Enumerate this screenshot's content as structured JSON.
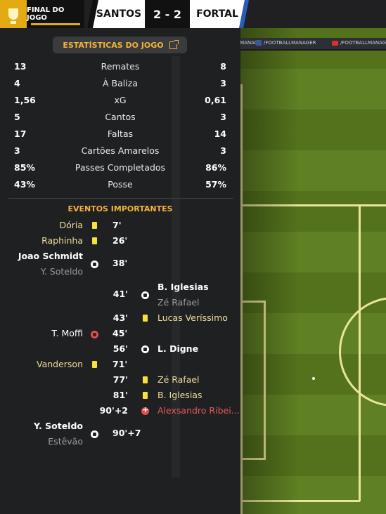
{
  "header": {
    "stage": "FINAL DO JOGO",
    "home_team": "SANTOS",
    "score": "2 - 2",
    "away_team": "FORTAL",
    "colors": {
      "accent": "#e4aa12",
      "home": "#111111",
      "away": "#2a5db8"
    }
  },
  "adboard": {
    "facebook": "/FOOTBALLMANAGER",
    "youtube": "/FOOTBALLMANAGE"
  },
  "stats": {
    "title": "ESTATÍSTICAS DO JOGO",
    "rows": [
      {
        "home": "13",
        "name": "Remates",
        "away": "8"
      },
      {
        "home": "4",
        "name": "À Baliza",
        "away": "3"
      },
      {
        "home": "1,56",
        "name": "xG",
        "away": "0,61"
      },
      {
        "home": "5",
        "name": "Cantos",
        "away": "3"
      },
      {
        "home": "17",
        "name": "Faltas",
        "away": "14"
      },
      {
        "home": "3",
        "name": "Cartões Amarelos",
        "away": "3"
      },
      {
        "home": "85%",
        "name": "Passes Completados",
        "away": "86%"
      },
      {
        "home": "43%",
        "name": "Posse",
        "away": "57%"
      }
    ]
  },
  "events": {
    "title": "EVENTOS IMPORTANTES",
    "items": [
      {
        "side": "home",
        "player": "Dória",
        "minute": "7'",
        "type": "yellow-card"
      },
      {
        "side": "home",
        "player": "Raphinha",
        "minute": "26'",
        "type": "yellow-card"
      },
      {
        "side": "home",
        "player": "Joao Schmidt",
        "assist": "Y. Soteldo",
        "minute": "38'",
        "type": "goal"
      },
      {
        "side": "away",
        "player": "B. Iglesias",
        "assist": "Zé Rafael",
        "minute": "41'",
        "type": "goal"
      },
      {
        "side": "away",
        "player": "Lucas Veríssimo",
        "minute": "43'",
        "type": "yellow-card"
      },
      {
        "side": "home",
        "player": "T. Moffi",
        "minute": "45'",
        "type": "own-goal"
      },
      {
        "side": "away",
        "player": "L. Digne",
        "minute": "56'",
        "type": "goal"
      },
      {
        "side": "home",
        "player": "Vanderson",
        "minute": "71'",
        "type": "yellow-card"
      },
      {
        "side": "away",
        "player": "Zé Rafael",
        "minute": "77'",
        "type": "yellow-card"
      },
      {
        "side": "away",
        "player": "B. Iglesias",
        "minute": "81'",
        "type": "yellow-card"
      },
      {
        "side": "away",
        "player": "Alexsandro Ribei...",
        "minute": "90'+2",
        "type": "missed-chance"
      },
      {
        "side": "home",
        "player": "Y. Soteldo",
        "assist": "Estêvão",
        "minute": "90'+7",
        "type": "goal"
      }
    ]
  }
}
